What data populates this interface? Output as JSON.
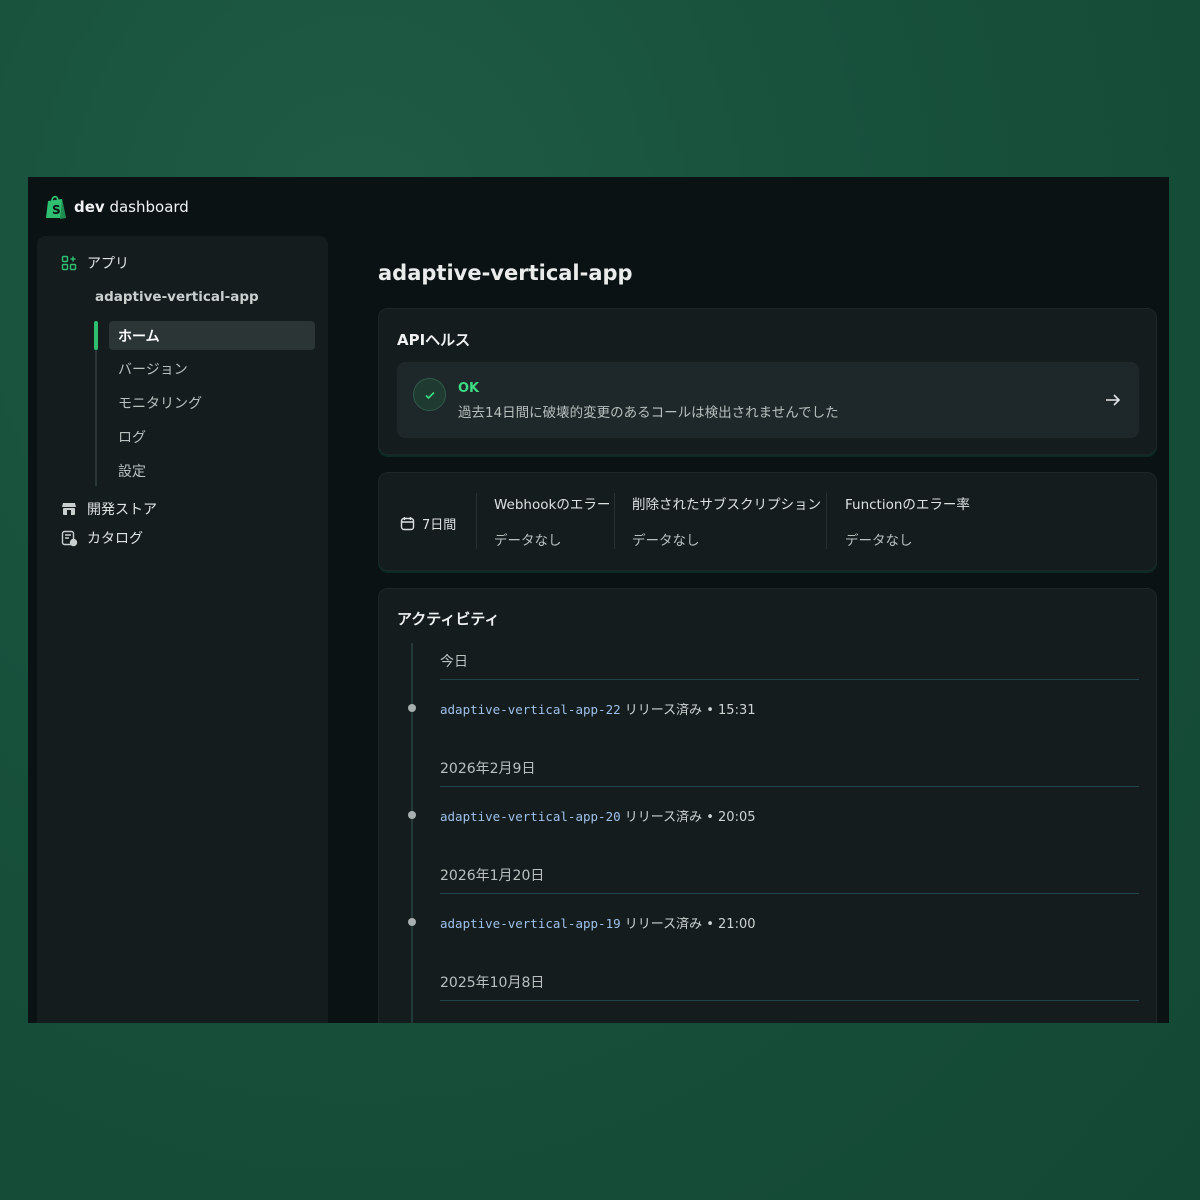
{
  "brand": {
    "bold": "dev",
    "rest": " dashboard"
  },
  "sidebar": {
    "apps_label": "アプリ",
    "app_name": "adaptive-vertical-app",
    "subnav": [
      "ホーム",
      "バージョン",
      "モニタリング",
      "ログ",
      "設定"
    ],
    "dev_store_label": "開発ストア",
    "catalog_label": "カタログ"
  },
  "main": {
    "title": "adaptive-vertical-app",
    "api_health": {
      "title": "APIヘルス",
      "status": "OK",
      "description": "過去14日間に破壊的変更のあるコールは検出されませんでした"
    },
    "metrics": {
      "period": "7日間",
      "items": [
        {
          "label": "Webhookのエラー",
          "value": "データなし"
        },
        {
          "label": "削除されたサブスクリプション",
          "value": "データなし"
        },
        {
          "label": "Functionのエラー率",
          "value": "データなし"
        }
      ]
    },
    "activity": {
      "title": "アクティビティ",
      "groups": [
        {
          "date": "今日",
          "app": "adaptive-vertical-app-22",
          "status": " リリース済み • 15:31"
        },
        {
          "date": "2026年2月9日",
          "app": "adaptive-vertical-app-20",
          "status": " リリース済み • 20:05"
        },
        {
          "date": "2026年1月20日",
          "app": "adaptive-vertical-app-19",
          "status": " リリース済み • 21:00"
        },
        {
          "date": "2025年10月8日"
        }
      ]
    }
  },
  "colors": {
    "accent": "#2fbf71",
    "ok": "#3ddc84",
    "background": "#17503b"
  }
}
